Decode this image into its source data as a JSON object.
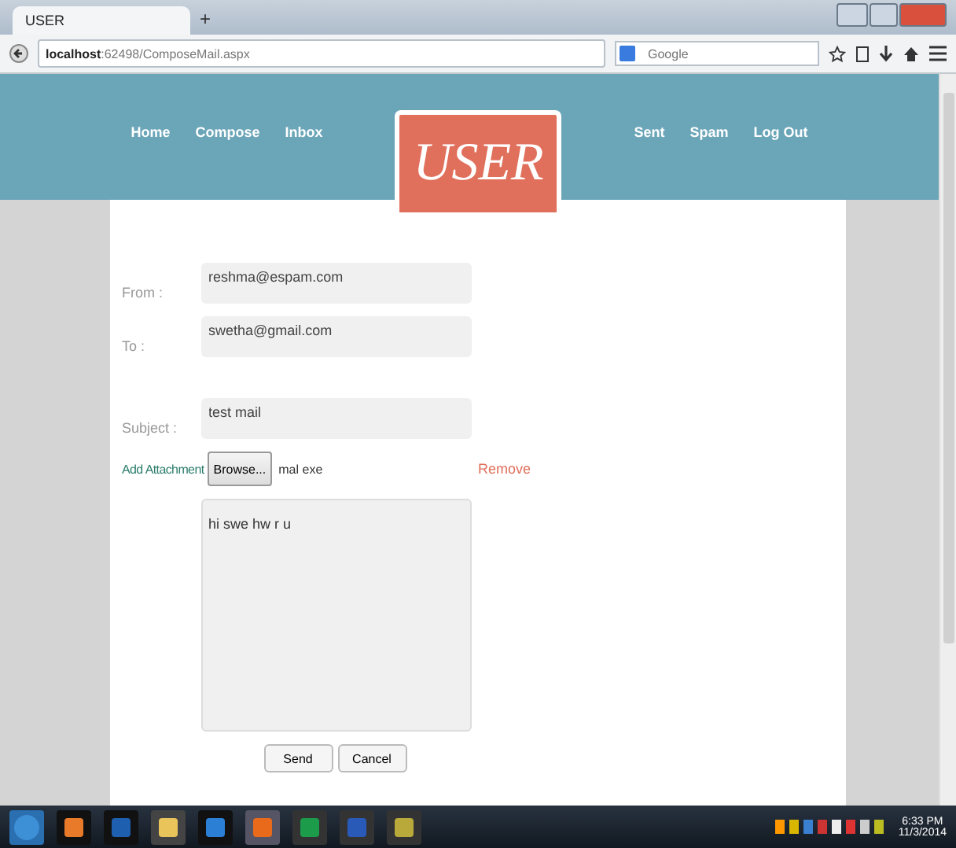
{
  "browser": {
    "tabs": [
      {
        "label": "USER",
        "selected": true
      }
    ],
    "new_tab": "+",
    "address": "**localhost**:62498/ComposeMail.aspx",
    "search": {
      "placeholder": "Google"
    }
  },
  "site": {
    "nav_left": [
      "Home",
      "Compose",
      "Inbox"
    ],
    "logo": "USER",
    "nav_right": [
      "Sent",
      "Spam",
      "Log Out"
    ]
  },
  "form": {
    "fields": [
      {
        "label": "From :",
        "value": "reshma@espam.com"
      },
      {
        "label": "To :",
        "value": "swetha@gmail.com"
      },
      {
        "label": "Subject :",
        "value": "test mail"
      }
    ],
    "attachment": {
      "label": "Add Attachment",
      "browse": "Browse...",
      "file": "mal exe",
      "remove": "Remove"
    },
    "message": "hi swe hw r u",
    "buttons": [
      "Send",
      "Cancel"
    ]
  },
  "taskbar": {
    "time": "6:33 PM",
    "date": "11/3/2014"
  }
}
